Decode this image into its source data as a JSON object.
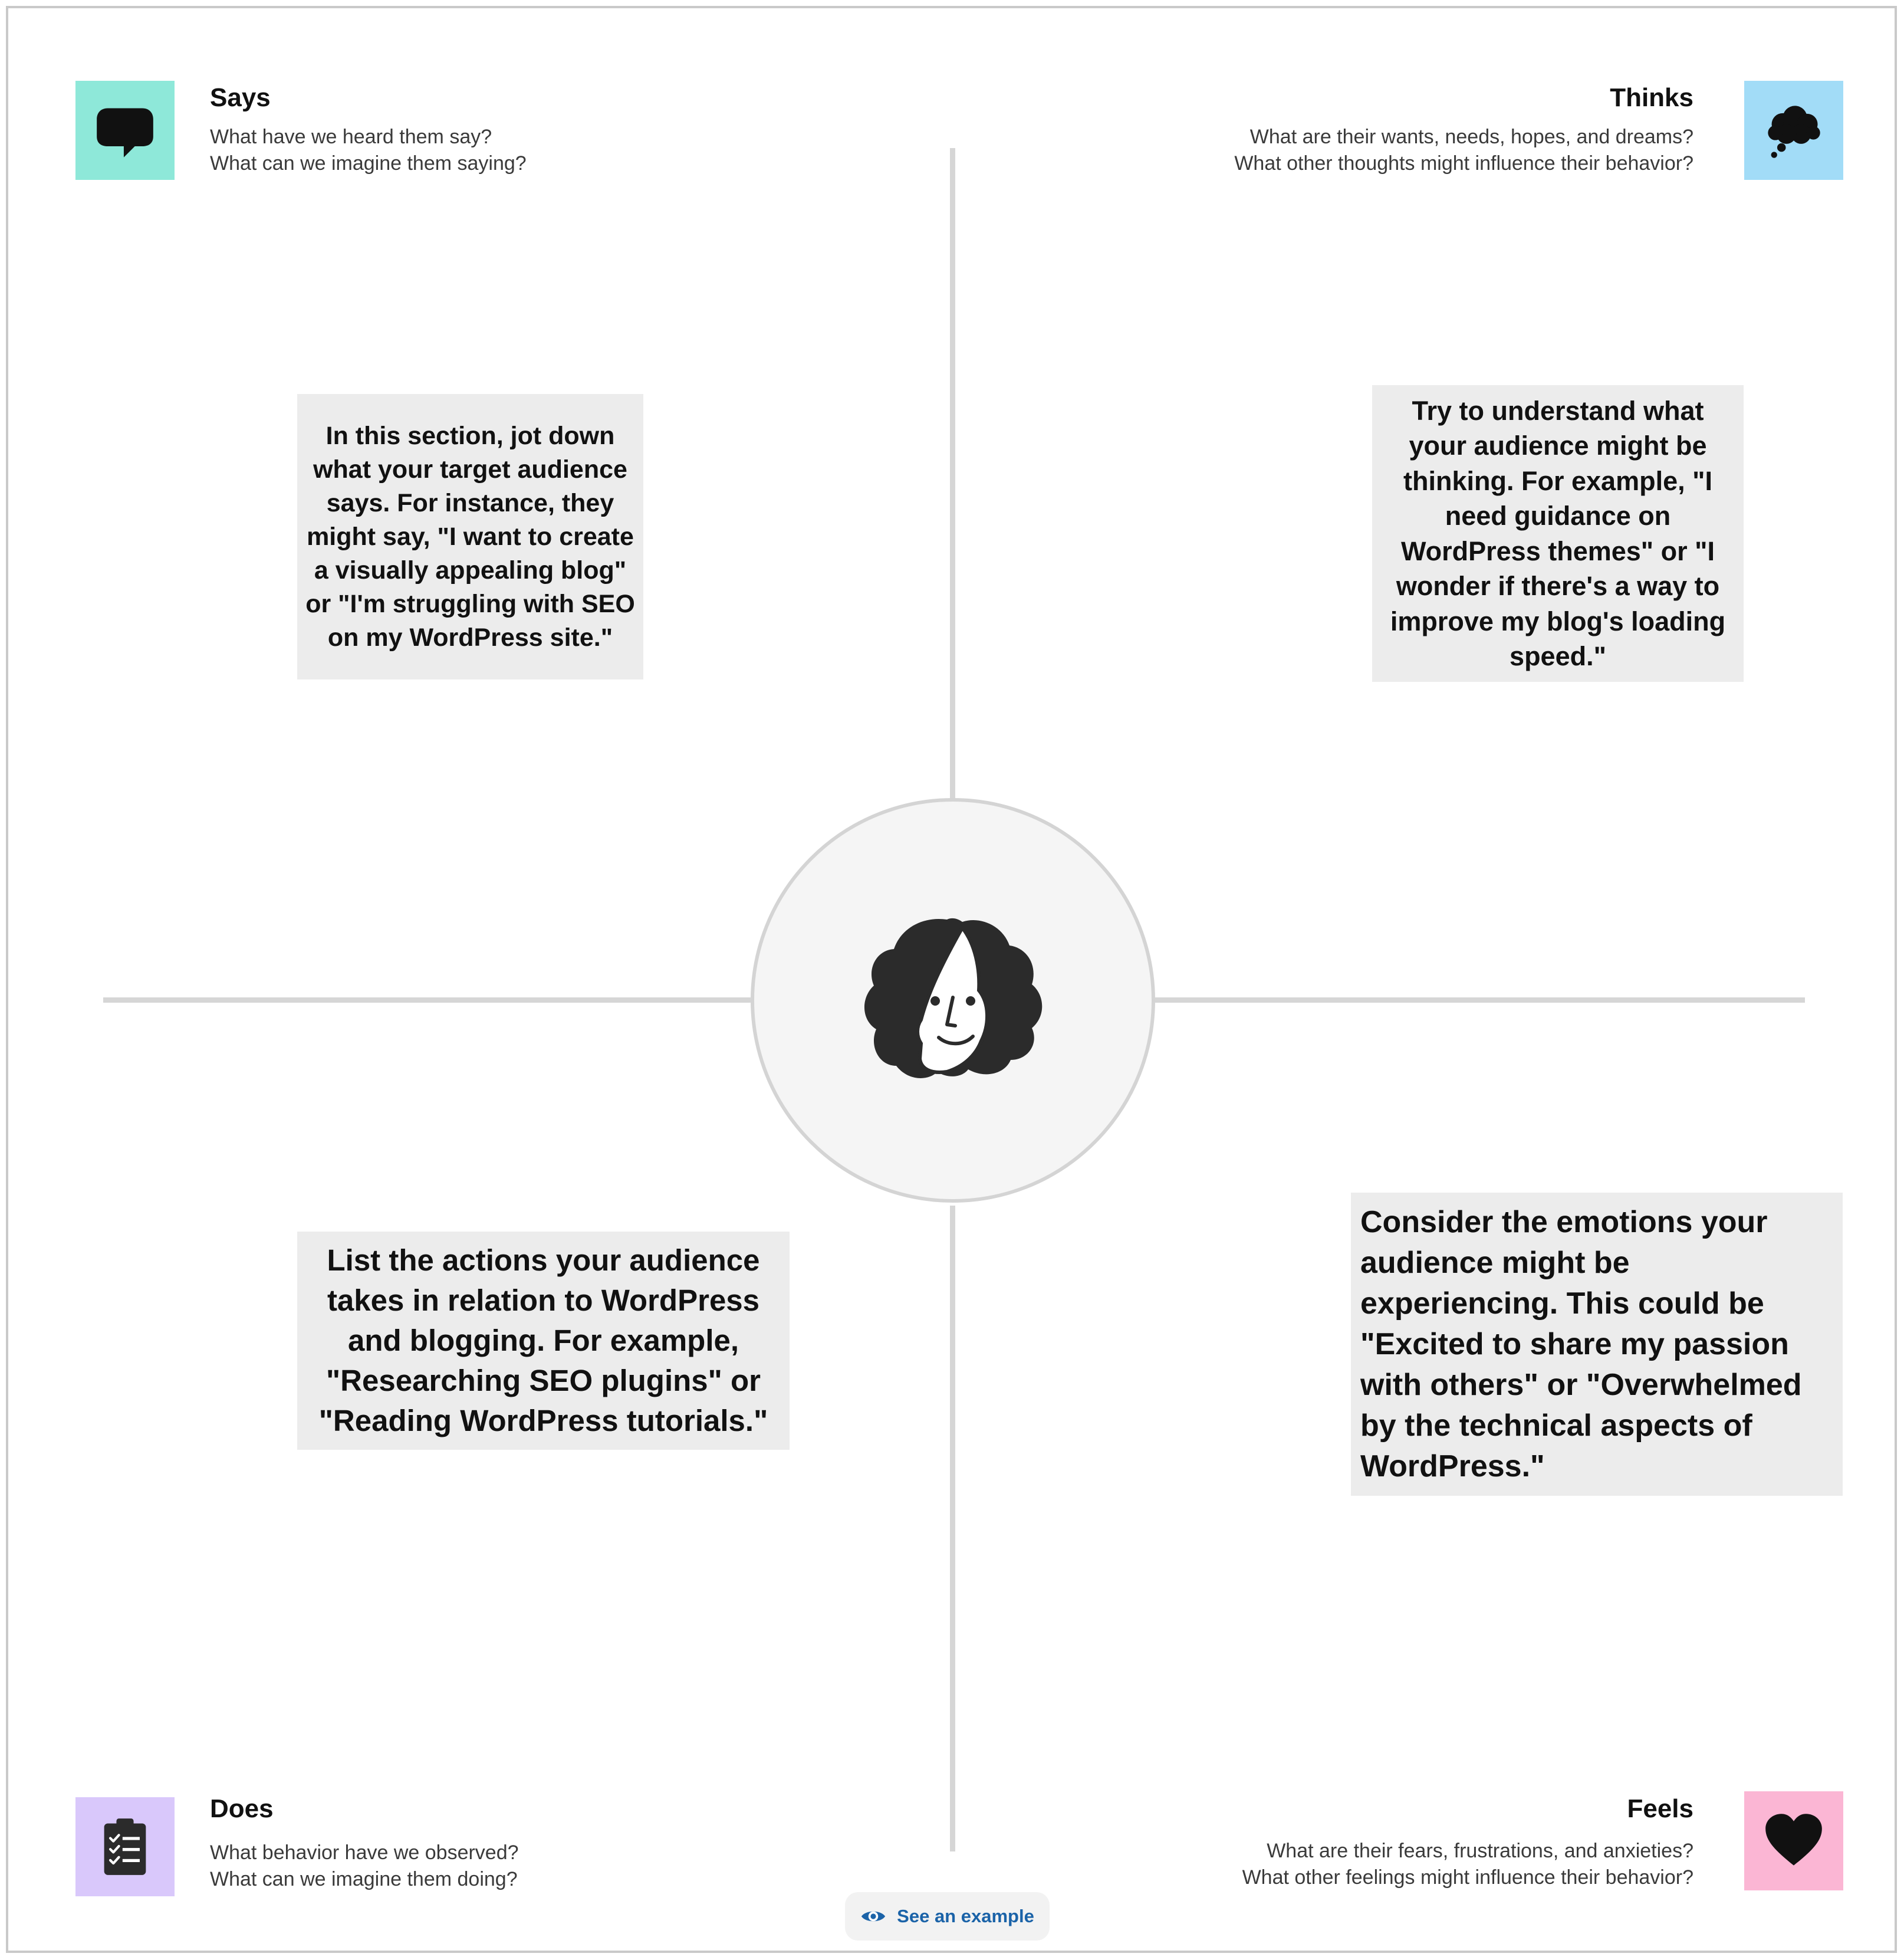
{
  "quadrants": {
    "says": {
      "title": "Says",
      "prompt_1": "What have we heard them say?",
      "prompt_2": "What can we imagine them saying?",
      "note": "In this section, jot down what your target audience says. For instance, they might say, \"I want to create a visually appealing blog\" or \"I'm struggling with SEO on my WordPress site.\"",
      "icon": "speech-bubble-icon",
      "color": "#8ee8d9"
    },
    "thinks": {
      "title": "Thinks",
      "prompt_1": "What are their wants, needs, hopes, and dreams?",
      "prompt_2": "What other thoughts might influence their behavior?",
      "note": "Try to understand what your audience might be thinking. For example, \"I need guidance on WordPress themes\" or \"I wonder if there's a way to improve my blog's loading speed.\"",
      "icon": "thought-cloud-icon",
      "color": "#a2dcf7"
    },
    "does": {
      "title": "Does",
      "prompt_1": "What behavior have we observed?",
      "prompt_2": "What can we imagine them doing?",
      "note": "List the actions your audience takes in relation to WordPress and blogging. For example, \"Researching SEO plugins\" or \"Reading WordPress tutorials.\"",
      "icon": "clipboard-checklist-icon",
      "color": "#d9c8fb"
    },
    "feels": {
      "title": "Feels",
      "prompt_1": "What are their fears, frustrations, and anxieties?",
      "prompt_2": "What other feelings might influence their behavior?",
      "note": "Consider the emotions your audience might be experiencing. This could be \"Excited to share my passion with others\" or \"Overwhelmed by the technical aspects of WordPress.\"",
      "icon": "heart-icon",
      "color": "#fbb6d4"
    }
  },
  "center": {
    "icon": "persona-face-icon"
  },
  "example_button": {
    "label": "See an example",
    "icon": "eye-icon",
    "color": "#1b63a8"
  }
}
